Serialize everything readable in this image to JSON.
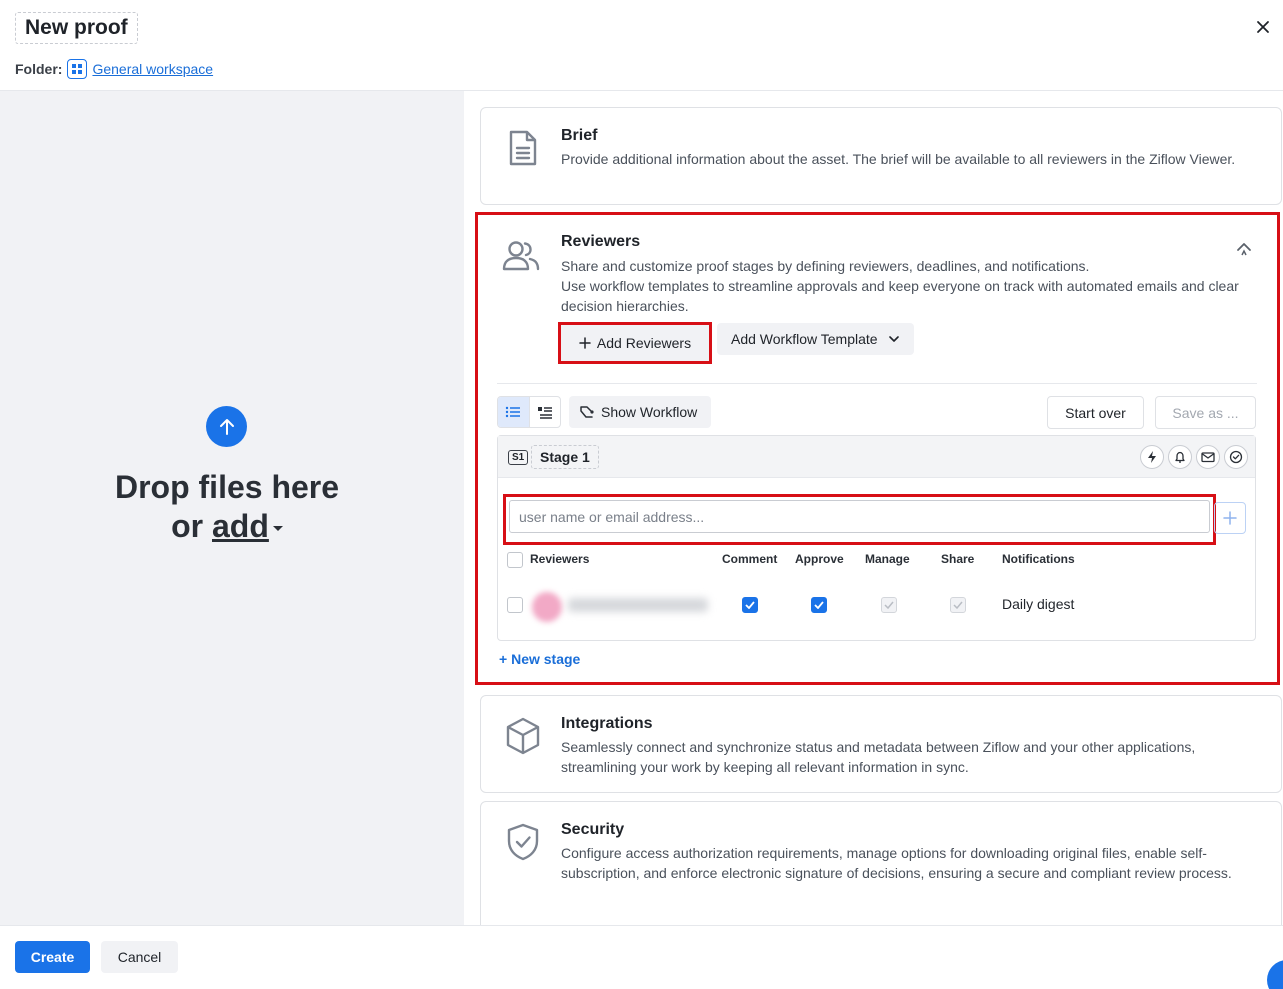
{
  "header": {
    "title": "New proof",
    "folder_label": "Folder:",
    "folder_name": "General workspace"
  },
  "dropzone": {
    "line1": "Drop files here",
    "line2_prefix": "or",
    "line2_link": "add"
  },
  "brief": {
    "title": "Brief",
    "description": "Provide additional information about the asset. The brief will be available to all reviewers in the Ziflow Viewer."
  },
  "reviewers": {
    "title": "Reviewers",
    "description_1": "Share and customize proof stages by defining reviewers, deadlines, and notifications.",
    "description_2": "Use workflow templates to streamline approvals and keep everyone on track with automated emails and clear decision hierarchies.",
    "add_reviewers_label": "Add Reviewers",
    "add_workflow_label": "Add Workflow Template",
    "show_workflow_label": "Show Workflow",
    "start_over_label": "Start over",
    "save_as_label": "Save as ...",
    "stage": {
      "badge": "S1",
      "name": "Stage 1",
      "input_placeholder": "user name or email address...",
      "columns": [
        "Reviewers",
        "Comment",
        "Approve",
        "Manage",
        "Share",
        "Notifications"
      ],
      "rows": [
        {
          "notifications": "Daily digest",
          "comment": true,
          "approve": true,
          "manage": true,
          "share": true
        }
      ]
    },
    "new_stage_label": "New stage"
  },
  "integrations": {
    "title": "Integrations",
    "description": "Seamlessly connect and synchronize status and metadata between Ziflow and your other applications, streamlining your work by keeping all relevant information in sync."
  },
  "security": {
    "title": "Security",
    "description": "Configure access authorization requirements, manage options for downloading original files, enable self-subscription, and enforce electronic signature of decisions, ensuring a secure and compliant review process."
  },
  "footer": {
    "create_label": "Create",
    "cancel_label": "Cancel"
  },
  "colors": {
    "accent": "#1a73e8",
    "highlight": "#d70f16"
  }
}
